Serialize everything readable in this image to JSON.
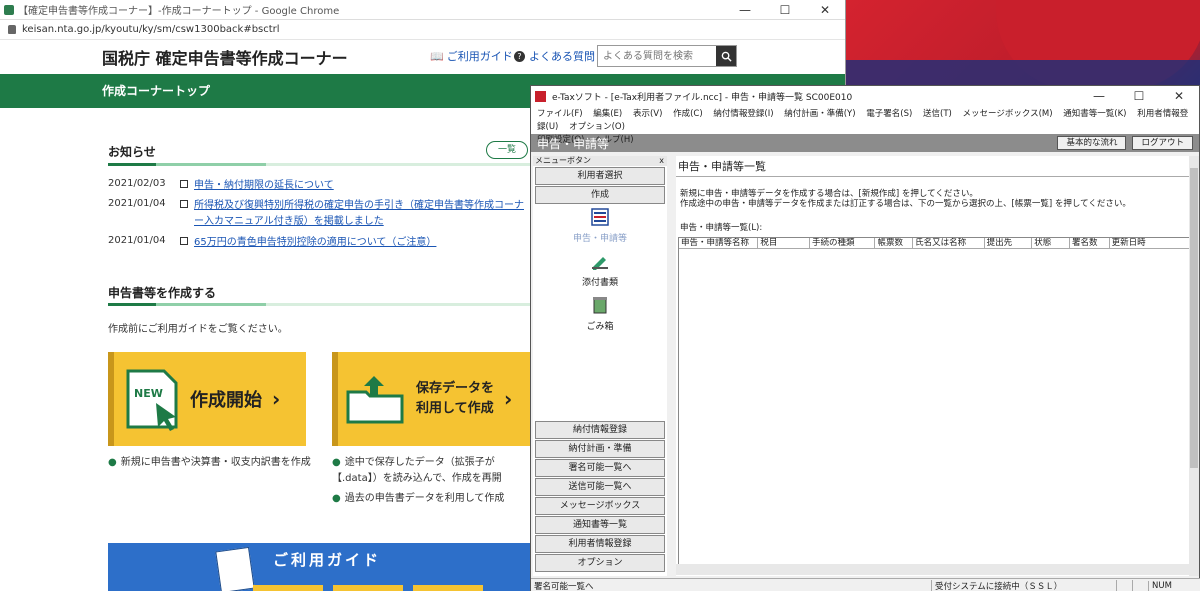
{
  "chrome": {
    "window_title": "【確定申告書等作成コーナー】-作成コーナートップ - Google Chrome",
    "url": "keisan.nta.go.jp/kyoutu/ky/sm/csw1300back#bsctrl",
    "ctrl_min": "—",
    "ctrl_max": "☐",
    "ctrl_close": "✕"
  },
  "site": {
    "title": "国税庁 確定申告書等作成コーナー",
    "help_label": "ご利用ガイド",
    "faq_label": "よくある質問",
    "search_placeholder": "よくある質問を検索",
    "greenbar": "作成コーナートップ"
  },
  "notice": {
    "heading": "お知らせ",
    "more": "一覧",
    "items": [
      {
        "date": "2021/02/03",
        "text": "申告・納付期限の延長について"
      },
      {
        "date": "2021/01/04",
        "text": "所得税及び復興特別所得税の確定申告の手引き（確定申告書等作成コーナー入カマニュアル付き版）を掲載しました"
      },
      {
        "date": "2021/01/04",
        "text": "65万円の青色申告特別控除の適用について（ご注意）"
      }
    ]
  },
  "create": {
    "heading": "申告書等を作成する",
    "sub": "作成前にご利用ガイドをご覧ください。",
    "card1_label": "作成開始",
    "card1_badge": "NEW",
    "card2_line1": "保存データを",
    "card2_line2": "利用して作成",
    "bullets1": [
      "新規に申告書や決算書・収支内訳書を作成"
    ],
    "bullets2": [
      "途中で保存したデータ（拡張子が【.data】）を読み込んで、作成を再開",
      "過去の申告書データを利用して作成"
    ],
    "guide_title": "ご利用ガイド"
  },
  "etax": {
    "title": "e-Taxソフト - [e-Tax利用者ファイル.ncc] - 申告・申請等一覧 SC00E010",
    "menus": [
      "ファイル(F)",
      "編集(E)",
      "表示(V)",
      "作成(C)",
      "納付情報登録(I)",
      "納付計画・準備(Y)",
      "電子署名(S)",
      "送信(T)",
      "メッセージボックス(M)",
      "通知書等一覧(K)",
      "利用者情報登録(U)",
      "オプション(O)",
      "印刷設定(Q)",
      "ヘルプ(H)"
    ],
    "band_title": "申告・申請等",
    "btn_basic": "基本的な流れ",
    "btn_logout": "ログアウト",
    "menu_header": "メニューボタン",
    "menu_close": "x",
    "top_buttons": [
      "利用者選択",
      "作成"
    ],
    "icons": [
      {
        "label": "申告・申請等"
      },
      {
        "label": "添付書類"
      },
      {
        "label": "ごみ箱"
      }
    ],
    "bottom_buttons": [
      "納付情報登録",
      "納付計画・準備",
      "署名可能一覧へ",
      "送信可能一覧へ",
      "メッセージボックス",
      "通知書等一覧",
      "利用者情報登録",
      "オプション"
    ],
    "content_heading": "申告・申請等一覧",
    "instructions": [
      "新規に申告・申請等データを作成する場合は、[新規作成] を押してください。",
      "作成途中の申告・申請等データを作成または訂正する場合は、下の一覧から選択の上、[帳票一覧] を押してください。"
    ],
    "list_label": "申告・申請等一覧(L):",
    "columns": [
      "申告・申請等名称",
      "税目",
      "手続の種類",
      "帳票数",
      "氏名又は名称",
      "提出先",
      "状態",
      "署名数",
      "更新日時"
    ],
    "status_left": "署名可能一覧へ",
    "status_mid": "受付システムに接続中（ＳＳＬ）",
    "status_num": "NUM"
  }
}
